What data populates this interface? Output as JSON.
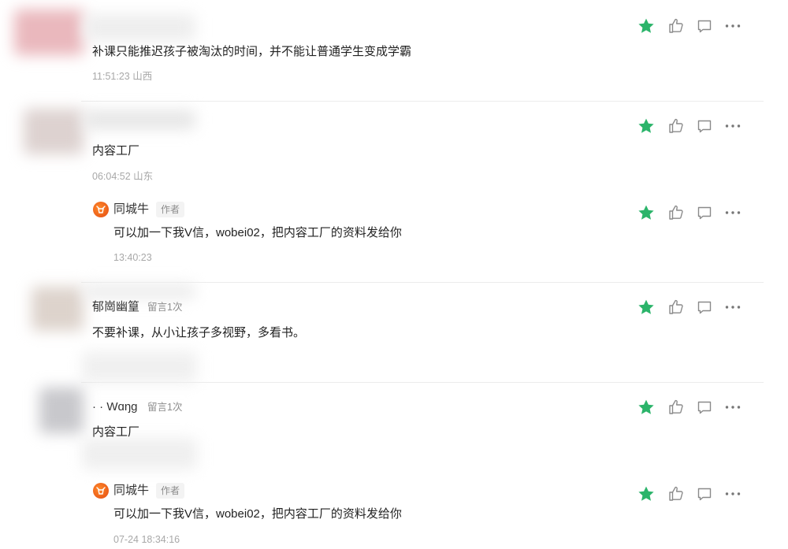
{
  "comments": [
    {
      "id": "c1",
      "text": "补课只能推迟孩子被淘汰的时间，并不能让普通学生变成学霸",
      "meta": "11:51:23 山西",
      "starred": true
    },
    {
      "id": "c2",
      "text": "内容工厂",
      "meta": "06:04:52 山东",
      "starred": true,
      "reply": {
        "name": "同城牛",
        "badge": "作者",
        "text": "可以加一下我V信，wobei02，把内容工厂的资料发给你",
        "meta": "13:40:23",
        "starred": true
      }
    },
    {
      "id": "c3",
      "name": "郁崗幽篁",
      "count": "留言1次",
      "text": "不要补课，从小让孩子多视野，多看书。",
      "starred": true
    },
    {
      "id": "c4",
      "name": "· · Wɑŋg",
      "count": "留言1次",
      "text": "内容工厂",
      "starred": true,
      "reply": {
        "name": "同城牛",
        "badge": "作者",
        "text": "可以加一下我V信，wobei02，把内容工厂的资料发给你",
        "meta": "07-24 18:34:16",
        "starred": true
      }
    }
  ],
  "icons": {
    "star": "star-icon",
    "like": "thumbs-up-icon",
    "reply": "comment-icon",
    "more": "more-icon"
  },
  "colors": {
    "star": "#2bb46a",
    "icon": "#8a8a8a",
    "divider": "#ececec",
    "meta": "#a8a8a8"
  }
}
